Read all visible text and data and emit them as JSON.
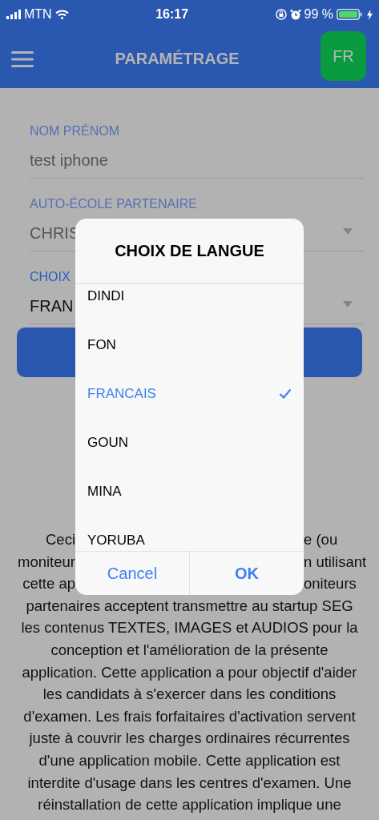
{
  "status_bar": {
    "carrier": "MTN",
    "time": "16:17",
    "battery": "99 %"
  },
  "header": {
    "title": "PARAMÉTRAGE",
    "language_button": "FR"
  },
  "form": {
    "fields": [
      {
        "label": "NOM PRÉNOM",
        "value": "test iphone",
        "kind": "text",
        "focused": false
      },
      {
        "label": "AUTO-ÉCOLE PARTENAIRE",
        "value": "CHRIS",
        "kind": "select",
        "focused": false
      },
      {
        "label": "CHOIX",
        "value": "FRAN",
        "kind": "select",
        "focused": true
      }
    ]
  },
  "notice": {
    "lines": [
      {
        "left": "Ceci",
        "right": "e (ou"
      },
      {
        "left": "moniteur",
        "right": "n utilisant"
      },
      {
        "left": "cette ap",
        "right": "oniteurs"
      },
      {
        "text": "partenaires acceptent transmettre au startup SEG"
      },
      {
        "text": "les contenus TEXTES, IMAGES et AUDIOS pour la"
      },
      {
        "text": "conception et l'amélioration de la présente"
      },
      {
        "text": "application. Cette application a pour objectif d'aider"
      },
      {
        "text": "les candidats à s'exercer dans les conditions"
      },
      {
        "text": "d'examen. Les frais forfaitaires d'activation servent"
      },
      {
        "text": "juste à couvrir les charges ordinaires récurrentes"
      },
      {
        "text": "d'une application mobile. Cette application est"
      },
      {
        "text": "interdite d'usage dans les centres d'examen. Une"
      },
      {
        "text": "réinstallation de cette application implique une"
      }
    ]
  },
  "dialog": {
    "title": "CHOIX DE LANGUE",
    "options": [
      {
        "label": "DINDI",
        "selected": false
      },
      {
        "label": "FON",
        "selected": false
      },
      {
        "label": "FRANCAIS",
        "selected": true
      },
      {
        "label": "GOUN",
        "selected": false
      },
      {
        "label": "MINA",
        "selected": false
      },
      {
        "label": "YORUBA",
        "selected": false
      }
    ],
    "buttons": [
      {
        "label": "Cancel",
        "primary": false
      },
      {
        "label": "OK",
        "primary": true
      }
    ]
  }
}
